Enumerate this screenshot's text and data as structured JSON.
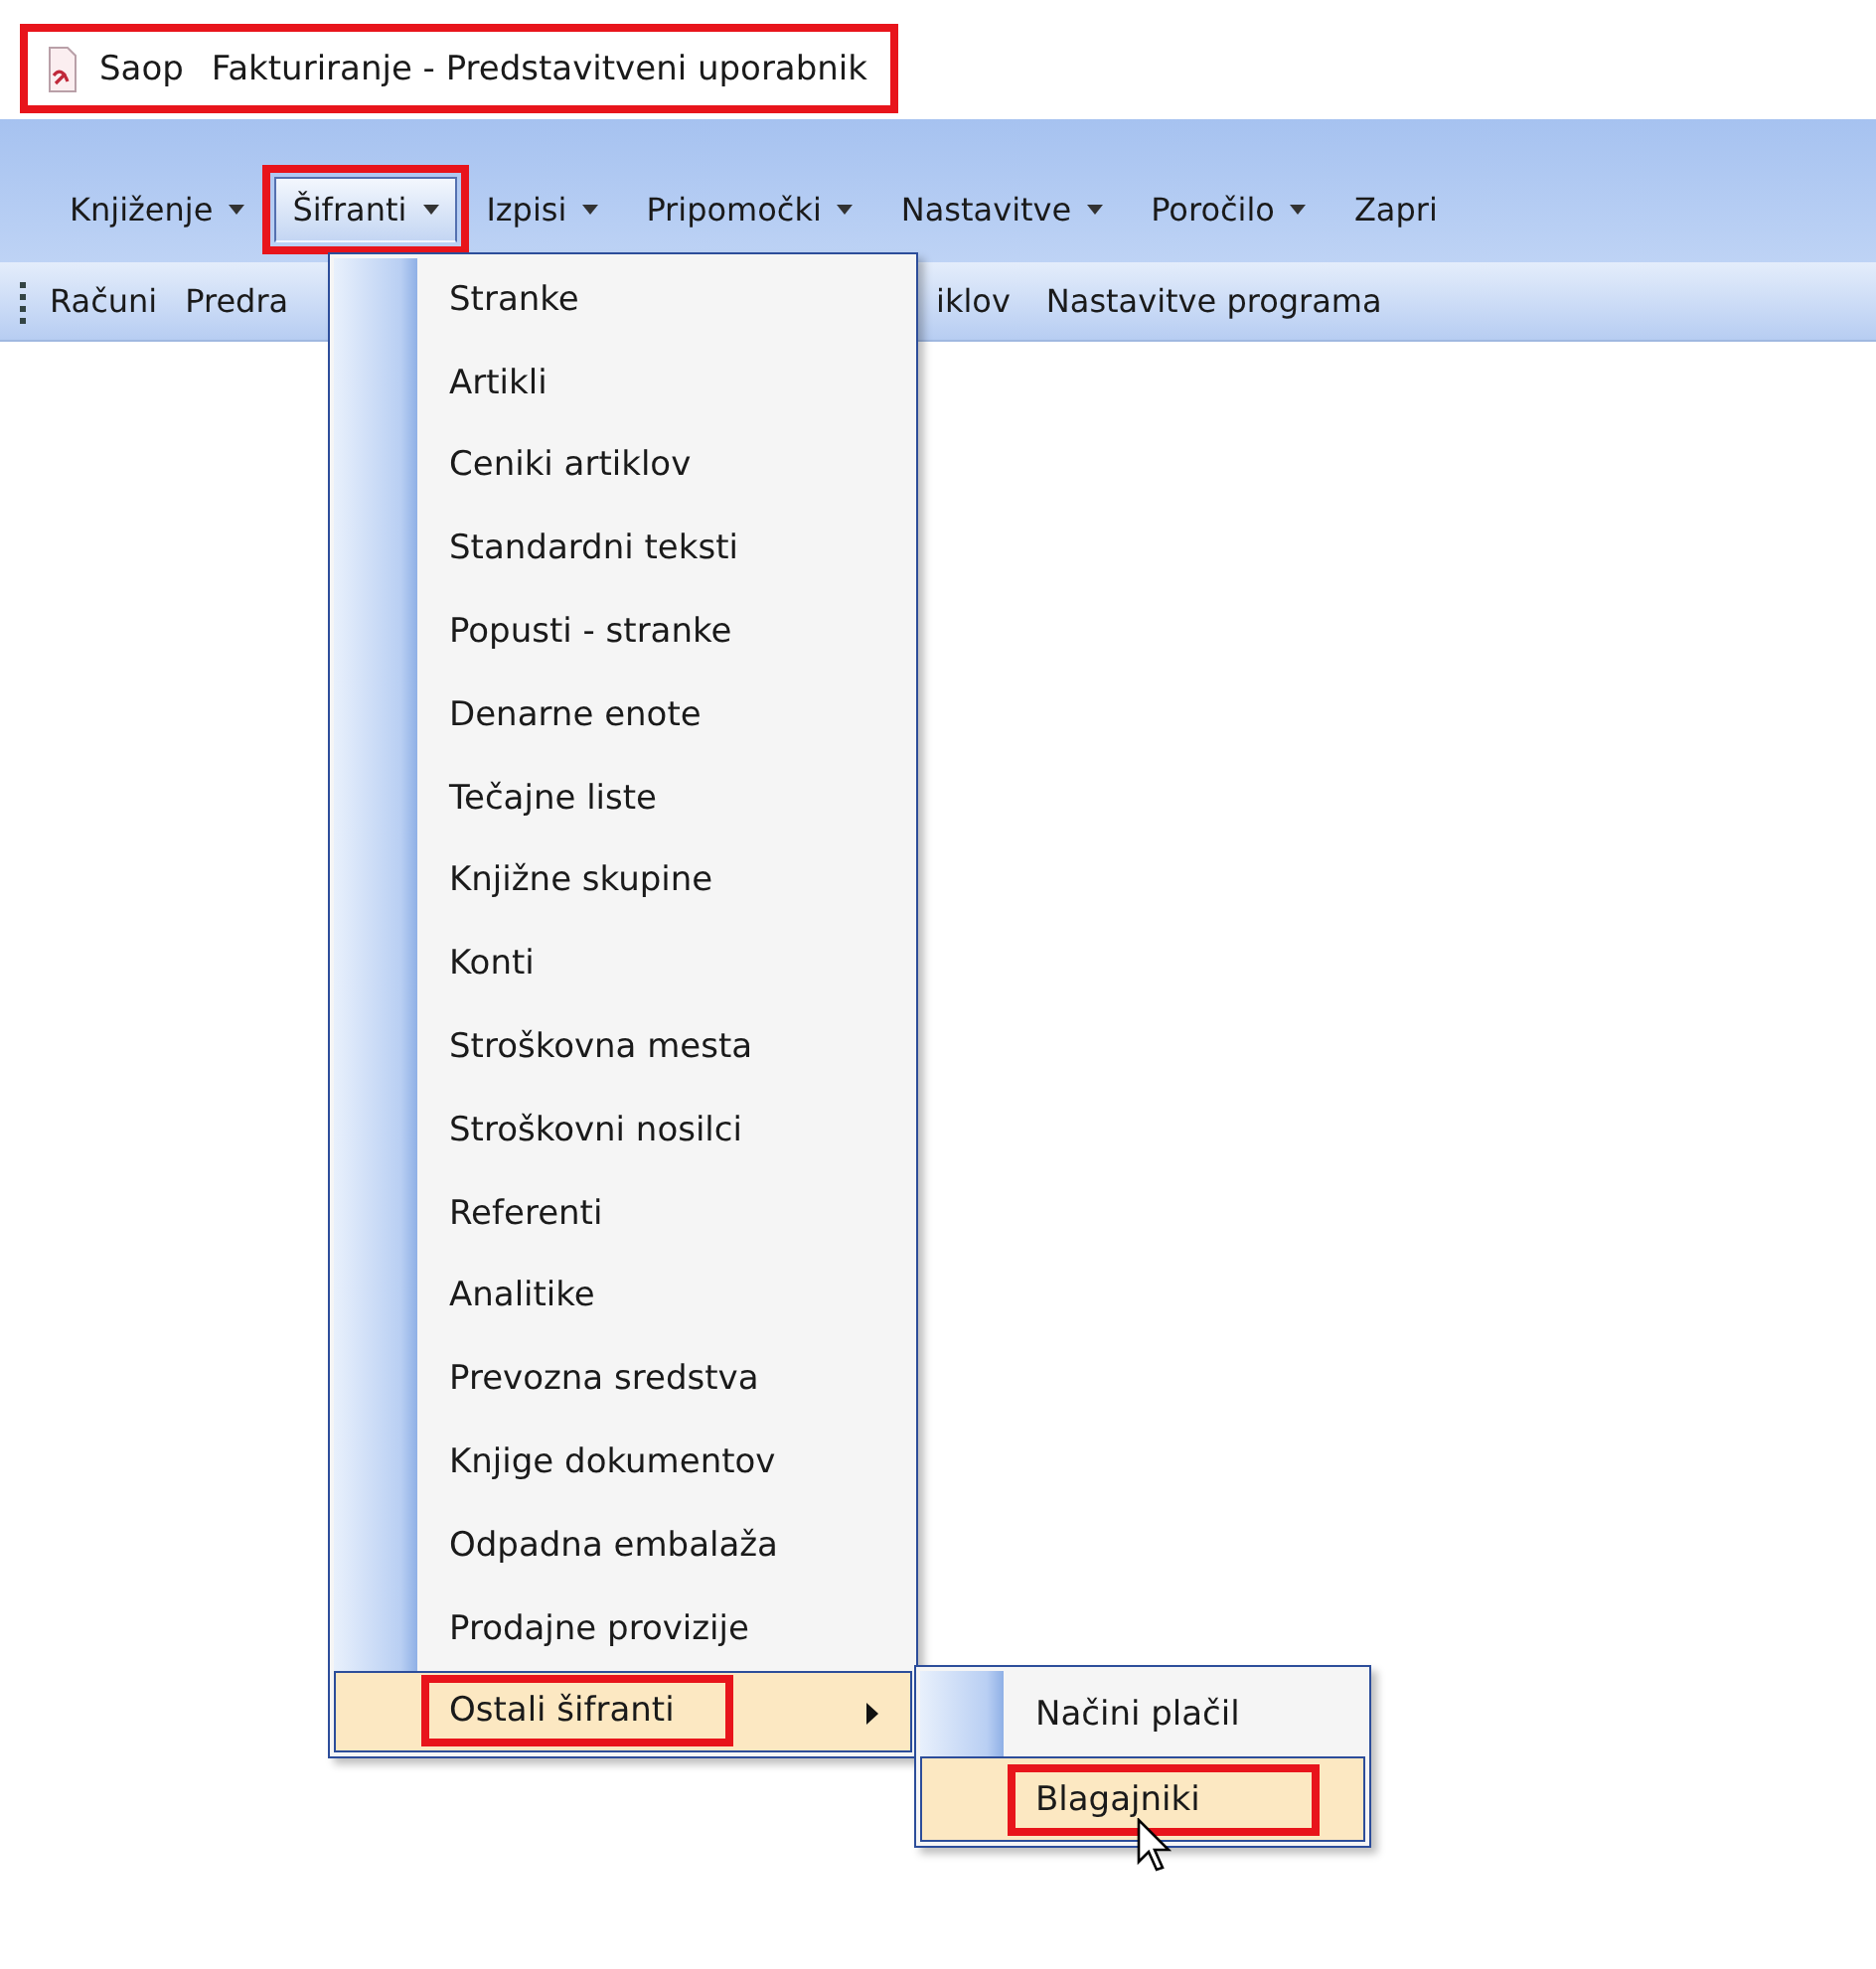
{
  "window": {
    "app_name": "Saop",
    "title": "Fakturiranje - Predstavitveni uporabnik",
    "highlighted": true
  },
  "menu_bar": [
    {
      "label": "Knjiženje",
      "has_dropdown": true,
      "open": false,
      "highlighted": false
    },
    {
      "label": "Šifranti",
      "has_dropdown": true,
      "open": true,
      "highlighted": true
    },
    {
      "label": "Izpisi",
      "has_dropdown": true,
      "open": false,
      "highlighted": false
    },
    {
      "label": "Pripomočki",
      "has_dropdown": true,
      "open": false,
      "highlighted": false
    },
    {
      "label": "Nastavitve",
      "has_dropdown": true,
      "open": false,
      "highlighted": false
    },
    {
      "label": "Poročilo",
      "has_dropdown": true,
      "open": false,
      "highlighted": false
    },
    {
      "label": "Zapri",
      "has_dropdown": false,
      "open": false,
      "highlighted": false
    }
  ],
  "toolbar": {
    "left": [
      "Računi",
      "Predra"
    ],
    "right": [
      "iklov",
      "Nastavitve programa"
    ]
  },
  "dropdown": {
    "items": [
      {
        "label": "Stranke",
        "submenu": false,
        "selected": false,
        "highlighted": false
      },
      {
        "label": "Artikli",
        "submenu": false,
        "selected": false,
        "highlighted": false
      },
      {
        "label": "Ceniki artiklov",
        "submenu": false,
        "selected": false,
        "highlighted": false
      },
      {
        "label": "Standardni teksti",
        "submenu": false,
        "selected": false,
        "highlighted": false
      },
      {
        "label": "Popusti - stranke",
        "submenu": false,
        "selected": false,
        "highlighted": false
      },
      {
        "label": "Denarne enote",
        "submenu": false,
        "selected": false,
        "highlighted": false
      },
      {
        "label": "Tečajne liste",
        "submenu": false,
        "selected": false,
        "highlighted": false
      },
      {
        "label": "Knjižne skupine",
        "submenu": false,
        "selected": false,
        "highlighted": false
      },
      {
        "label": "Konti",
        "submenu": false,
        "selected": false,
        "highlighted": false
      },
      {
        "label": "Stroškovna mesta",
        "submenu": false,
        "selected": false,
        "highlighted": false
      },
      {
        "label": "Stroškovni nosilci",
        "submenu": false,
        "selected": false,
        "highlighted": false
      },
      {
        "label": "Referenti",
        "submenu": false,
        "selected": false,
        "highlighted": false
      },
      {
        "label": "Analitike",
        "submenu": false,
        "selected": false,
        "highlighted": false
      },
      {
        "label": "Prevozna sredstva",
        "submenu": false,
        "selected": false,
        "highlighted": false
      },
      {
        "label": "Knjige dokumentov",
        "submenu": false,
        "selected": false,
        "highlighted": false
      },
      {
        "label": "Odpadna embalaža",
        "submenu": false,
        "selected": false,
        "highlighted": false
      },
      {
        "label": "Prodajne provizije",
        "submenu": false,
        "selected": false,
        "highlighted": false
      },
      {
        "label": "Ostali šifranti",
        "submenu": true,
        "selected": true,
        "highlighted": true
      }
    ]
  },
  "submenu": {
    "items": [
      {
        "label": "Načini plačil",
        "selected": false,
        "highlighted": false
      },
      {
        "label": "Blagajniki",
        "selected": true,
        "highlighted": true
      }
    ]
  }
}
